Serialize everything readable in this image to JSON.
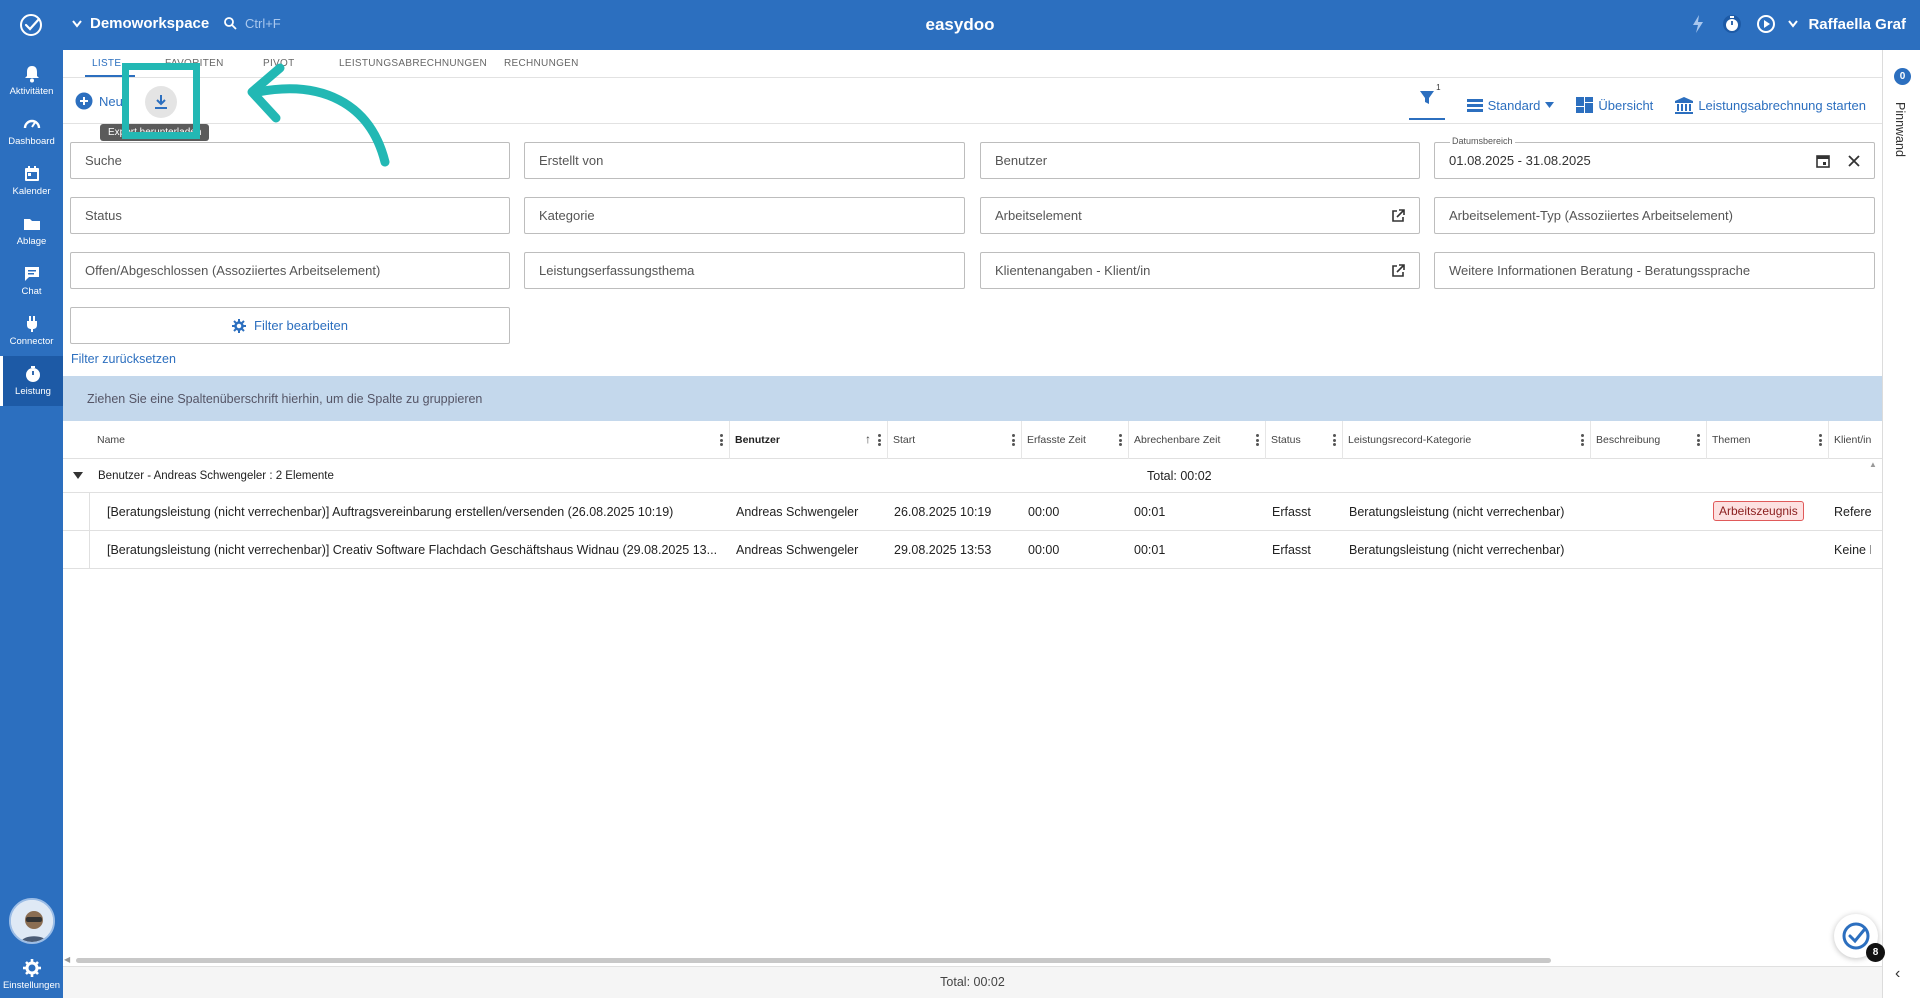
{
  "app": {
    "title": "easydoo",
    "workspace": "Demoworkspace",
    "search_shortcut": "Ctrl+F",
    "user_name": "Raffaella Graf",
    "accent_color": "#2c6fbf"
  },
  "sidebar": {
    "items": [
      {
        "label": "Aktivitäten",
        "icon": "bell-icon"
      },
      {
        "label": "Dashboard",
        "icon": "gauge-icon"
      },
      {
        "label": "Kalender",
        "icon": "calendar-icon"
      },
      {
        "label": "Ablage",
        "icon": "folder-icon"
      },
      {
        "label": "Chat",
        "icon": "chat-icon"
      },
      {
        "label": "Connector",
        "icon": "plug-icon"
      },
      {
        "label": "Leistung",
        "icon": "stopwatch-icon"
      }
    ],
    "settings_label": "Einstellungen"
  },
  "tabs": [
    "LISTE",
    "FAVORITEN",
    "PIVOT",
    "LEISTUNGSABRECHNUNGEN",
    "RECHNUNGEN"
  ],
  "toolbar": {
    "new_label": "Neu",
    "export_tooltip": "Export herunterladen",
    "filter_count": "1",
    "view_label": "Standard",
    "overview_label": "Übersicht",
    "billing_label": "Leistungsabrechnung starten"
  },
  "filters": {
    "suche": "Suche",
    "erstellt_von": "Erstellt von",
    "benutzer": "Benutzer",
    "datumsbereich_label": "Datumsbereich",
    "datumsbereich_value": "01.08.2025 - 31.08.2025",
    "status": "Status",
    "kategorie": "Kategorie",
    "arbeitselement": "Arbeitselement",
    "arbeitselement_typ": "Arbeitselement-Typ (Assoziiertes Arbeitselement)",
    "offen": "Offen/Abgeschlossen (Assoziiertes Arbeitselement)",
    "thema": "Leistungserfassungsthema",
    "klient": "Klientenangaben - Klient/in",
    "beratungssprache": "Weitere Informationen Beratung - Beratungssprache",
    "edit_label": "Filter bearbeiten",
    "reset_label": "Filter zurücksetzen"
  },
  "group_hint": "Ziehen Sie eine Spaltenüberschrift hierhin, um die Spalte zu gruppieren",
  "table": {
    "columns": [
      "Name",
      "Benutzer",
      "Start",
      "Erfasste Zeit",
      "Abrechenbare Zeit",
      "Status",
      "Leistungsrecord-Kategorie",
      "Beschreibung",
      "Themen",
      "Klient/in"
    ],
    "group": {
      "label": "Benutzer - Andreas Schwengeler : 2 Elemente",
      "total": "Total: 00:02"
    },
    "rows": [
      {
        "name": "[Beratungsleistung (nicht verrechenbar)] Auftragsvereinbarung erstellen/versenden (26.08.2025 10:19)",
        "benutzer": "Andreas Schwengeler",
        "start": "26.08.2025 10:19",
        "erfasst": "00:00",
        "abrechenbar": "00:01",
        "status": "Erfasst",
        "kategorie": "Beratungsleistung (nicht verrechenbar)",
        "beschreibung": "",
        "themen": "Arbeitszeugnis",
        "klient": "Referenz"
      },
      {
        "name": "[Beratungsleistung (nicht verrechenbar)] Creativ Software Flachdach Geschäftshaus Widnau (29.08.2025 13...",
        "benutzer": "Andreas Schwengeler",
        "start": "29.08.2025 13:53",
        "erfasst": "00:00",
        "abrechenbar": "00:01",
        "status": "Erfasst",
        "kategorie": "Beratungsleistung (nicht verrechenbar)",
        "beschreibung": "",
        "themen": "",
        "klient": "Keine F"
      }
    ],
    "footer_total": "Total: 00:02"
  },
  "right_panel": {
    "pin_count": "0",
    "label": "Pinnwand"
  },
  "fab_badge": "8"
}
